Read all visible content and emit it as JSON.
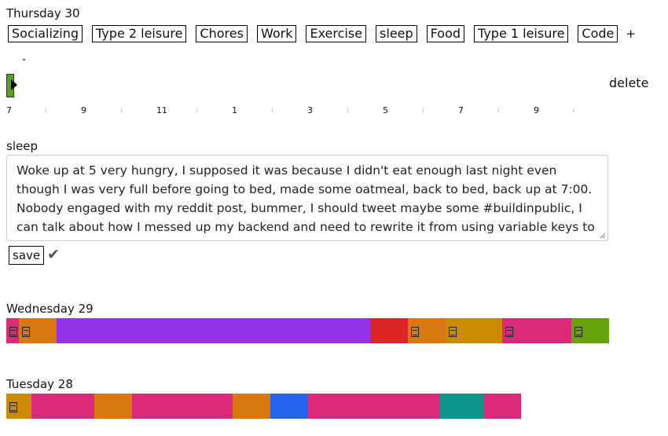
{
  "thursday": {
    "title": "Thursday 30",
    "categories": [
      "Socializing",
      "Type 2 leisure",
      "Chores",
      "Work",
      "Exercise",
      "sleep",
      "Food",
      "Type 1 leisure",
      "Code"
    ],
    "add_label": "+",
    "remove_label": "-",
    "delete_label": "delete",
    "hour_labels": [
      "7",
      "9",
      "11",
      "1",
      "3",
      "5",
      "7",
      "9"
    ],
    "selected_category": "sleep",
    "selected_color": "#5ca21a",
    "note": "Woke up at 5 very hungry, I supposed it was because I didn't eat enough last night even though I was very full before going to bed, made some oatmeal, back to bed, back up at 7:00. Nobody engaged with my reddit post, bummer, I should tweet maybe some #buildinpublic, I can talk about how I messed up my backend and need to rewrite it from using variable keys to fixed keys",
    "save_label": "save",
    "saved_icon": "check-icon"
  },
  "wednesday": {
    "title": "Wednesday 29",
    "segments": [
      {
        "color": "#dc2a7a",
        "weight": 16,
        "note": true
      },
      {
        "color": "#d9780f",
        "weight": 48,
        "note": true
      },
      {
        "color": "#9333ea",
        "weight": 399,
        "note": false
      },
      {
        "color": "#dc2626",
        "weight": 48,
        "note": false
      },
      {
        "color": "#d9780f",
        "weight": 48,
        "note": true
      },
      {
        "color": "#ca8a04",
        "weight": 72,
        "note": true
      },
      {
        "color": "#dc2a7a",
        "weight": 88,
        "note": true
      },
      {
        "color": "#65a30d",
        "weight": 48,
        "note": true
      }
    ]
  },
  "tuesday": {
    "title": "Tuesday 28",
    "segments": [
      {
        "color": "#ca8a04",
        "weight": 32,
        "note": true
      },
      {
        "color": "#dc2a7a",
        "weight": 80,
        "note": false
      },
      {
        "color": "#d9780f",
        "weight": 48,
        "note": false
      },
      {
        "color": "#dc2a7a",
        "weight": 128,
        "note": false
      },
      {
        "color": "#d9780f",
        "weight": 48,
        "note": false
      },
      {
        "color": "#2563eb",
        "weight": 48,
        "note": false
      },
      {
        "color": "#dc2a7a",
        "weight": 167,
        "note": false
      },
      {
        "color": "#0d9488",
        "weight": 56,
        "note": false
      },
      {
        "color": "#dc2a7a",
        "weight": 48,
        "note": false
      }
    ]
  }
}
